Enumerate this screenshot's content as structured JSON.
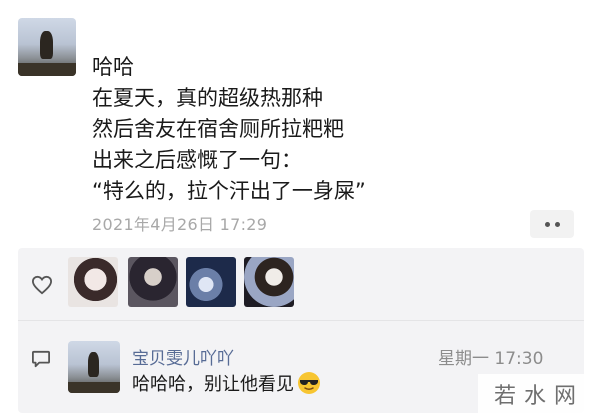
{
  "post": {
    "lines": [
      "哈哈",
      "在夏天，真的超级热那种",
      "然后舍友在宿舍厕所拉粑粑",
      "出来之后感慨了一句：",
      "“特么的，拉个汗出了一身屎”"
    ],
    "timestamp": "2021年4月26日 17:29"
  },
  "icons": {
    "like": "heart-icon",
    "comment": "comment-icon",
    "more": "more-dots-icon",
    "emoji": "sunglasses-emoji"
  },
  "comment": {
    "author": "宝贝雯儿吖吖",
    "time": "星期一 17:30",
    "text": "哈哈哈，别让他看见"
  },
  "watermark": "若水网",
  "colors": {
    "name_link": "#576b95",
    "interaction_bg": "#f3f3f5",
    "timestamp": "#a8a8a8"
  }
}
